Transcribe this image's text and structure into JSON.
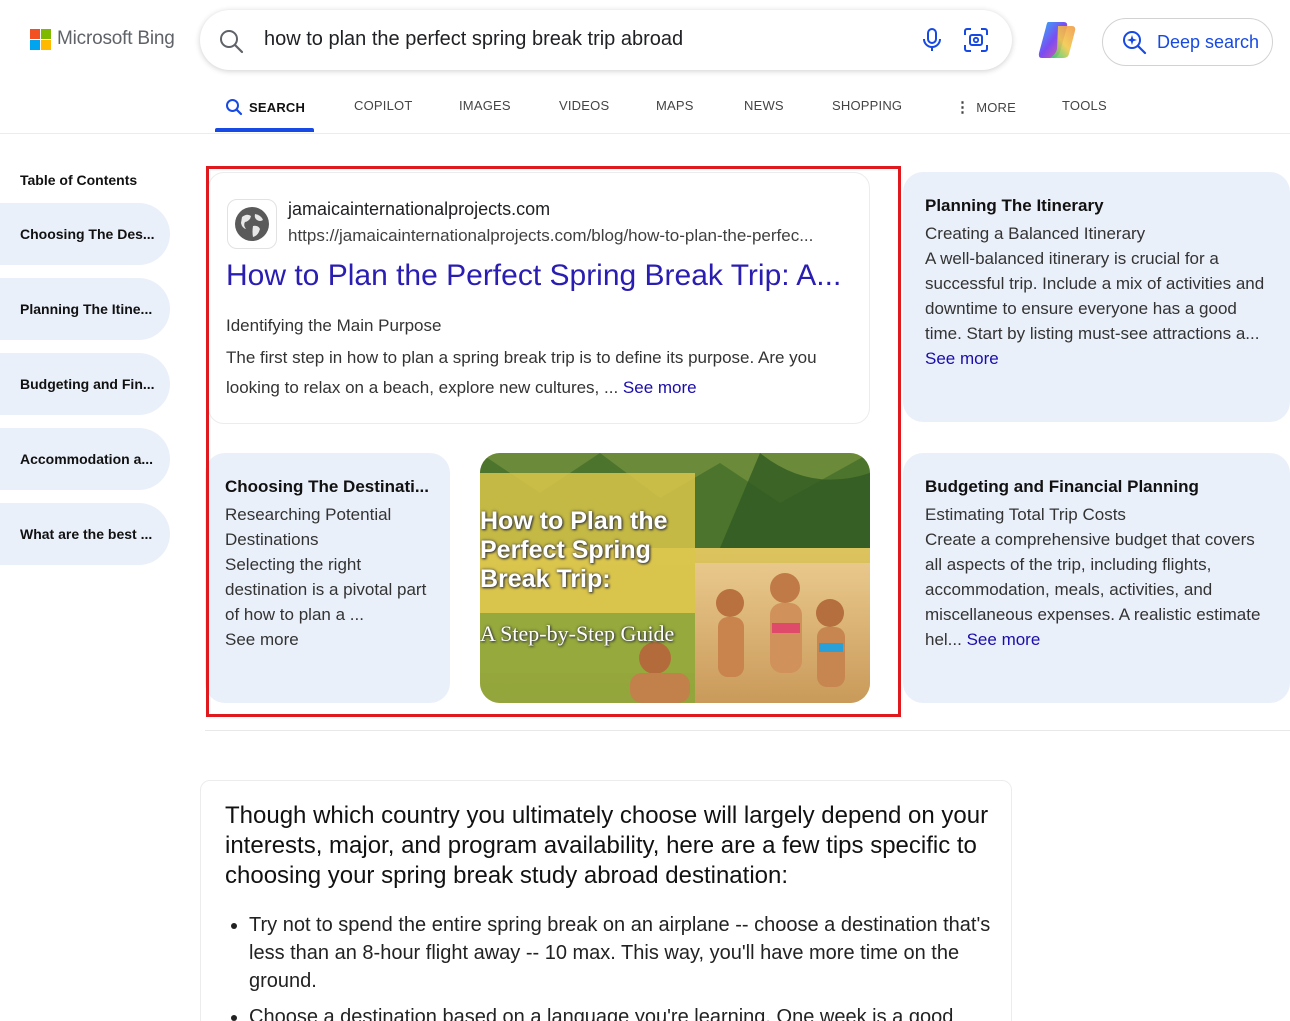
{
  "header": {
    "logo_text": "Microsoft Bing",
    "search_query": "how to plan the perfect spring break trip abroad",
    "deep_search_label": "Deep search"
  },
  "tabs": [
    {
      "label": "SEARCH",
      "active": true
    },
    {
      "label": "COPILOT"
    },
    {
      "label": "IMAGES"
    },
    {
      "label": "VIDEOS"
    },
    {
      "label": "MAPS"
    },
    {
      "label": "NEWS"
    },
    {
      "label": "SHOPPING"
    },
    {
      "label": "MORE"
    },
    {
      "label": "TOOLS"
    }
  ],
  "toc": {
    "title": "Table of Contents",
    "items": [
      "Choosing The Des...",
      "Planning The Itine...",
      "Budgeting and Fin...",
      "Accommodation a...",
      "What are the best ..."
    ]
  },
  "result": {
    "site_name": "jamaicainternationalprojects.com",
    "url": "https://jamaicainternationalprojects.com/blog/how-to-plan-the-perfec...",
    "title": "How to Plan the Perfect Spring Break Trip: A...",
    "subheading": "Identifying the Main Purpose",
    "snippet": "The first step in how to plan a spring break trip is to define its purpose. Are you looking to relax on a beach, explore new cultures, ... ",
    "see_more": "See more"
  },
  "card_choosing": {
    "title": "Choosing The Destinati...",
    "heading": "Researching Potential Destinations",
    "body": "Selecting the right destination is a pivotal part of how to plan a ...",
    "see_more": "See more"
  },
  "thumbnail": {
    "title_line1": "How to Plan the",
    "title_line2": "Perfect Spring",
    "title_line3": "Break Trip:",
    "subtitle": "A Step-by-Step Guide"
  },
  "card_itinerary": {
    "title": "Planning The Itinerary",
    "heading": "Creating a Balanced Itinerary",
    "body": "A well-balanced itinerary is crucial for a successful trip. Include a mix of activities and downtime to ensure everyone has a good time. Start by listing must-see attractions a... ",
    "see_more": "See more"
  },
  "card_budget": {
    "title": "Budgeting and Financial Planning",
    "heading": "Estimating Total Trip Costs",
    "body": "Create a comprehensive budget that covers all aspects of the trip, including flights, accommodation, meals, activities, and miscellaneous expenses. A realistic estimate hel... ",
    "see_more": "See more"
  },
  "answer": {
    "text": "Though which country you ultimately choose will largely depend on your interests, major, and program availability, here are a few tips specific to choosing your spring break study abroad destination:",
    "bullets": [
      "Try not to spend the entire spring break on an airplane -- choose a destination that's less than an 8-hour flight away -- 10 max. This way, you'll have more time on the ground.",
      "Choose a destination based on a language you're learning. One week is a good"
    ]
  },
  "colors": {
    "accent": "#174ae4",
    "title_link": "#2a1db1",
    "card_bg": "#eaf0fa",
    "highlight_border": "#e0191e"
  }
}
